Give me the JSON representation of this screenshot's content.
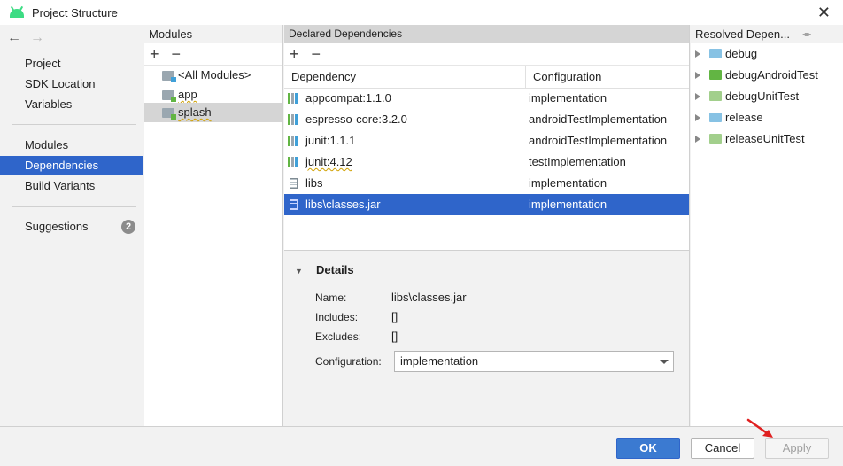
{
  "window": {
    "title": "Project Structure",
    "close_glyph": "✕"
  },
  "nav": {
    "back_glyph": "←",
    "forward_glyph": "→",
    "items": [
      {
        "label": "Project"
      },
      {
        "label": "SDK Location"
      },
      {
        "label": "Variables"
      },
      {
        "label": "Modules"
      },
      {
        "label": "Dependencies",
        "selected": true
      },
      {
        "label": "Build Variants"
      },
      {
        "label": "Suggestions",
        "badge": "2"
      }
    ]
  },
  "modules": {
    "header": "Modules",
    "minimize_glyph": "—",
    "add_glyph": "+",
    "remove_glyph": "−",
    "items": [
      {
        "label": "<All Modules>",
        "icon": "all-modules-icon"
      },
      {
        "label": "app",
        "icon": "module-icon"
      },
      {
        "label": "splash",
        "icon": "module-icon",
        "selected": true
      }
    ]
  },
  "declared": {
    "header": "Declared Dependencies",
    "add_glyph": "+",
    "remove_glyph": "−",
    "columns": [
      "Dependency",
      "Configuration"
    ],
    "rows": [
      {
        "name": "appcompat:1.1.0",
        "configuration": "implementation",
        "icon": "library-icon"
      },
      {
        "name": "espresso-core:3.2.0",
        "configuration": "androidTestImplementation",
        "icon": "library-icon"
      },
      {
        "name": "junit:1.1.1",
        "configuration": "androidTestImplementation",
        "icon": "library-icon"
      },
      {
        "name": "junit:4.12",
        "configuration": "testImplementation",
        "icon": "library-icon"
      },
      {
        "name": "libs",
        "configuration": "implementation",
        "icon": "jar-icon"
      },
      {
        "name": "libs\\classes.jar",
        "configuration": "implementation",
        "icon": "jar-icon",
        "selected": true
      }
    ]
  },
  "details": {
    "heading": "Details",
    "toggle_glyph": "▼",
    "name_label": "Name:",
    "name_value": "libs\\classes.jar",
    "includes_label": "Includes:",
    "includes_value": "[]",
    "excludes_label": "Excludes:",
    "excludes_value": "[]",
    "configuration_label": "Configuration:",
    "configuration_value": "implementation"
  },
  "resolved": {
    "header": "Resolved Depen...",
    "collapse_glyph": "⌯",
    "minimize_glyph": "—",
    "items": [
      {
        "label": "debug",
        "color": "#87c2e4"
      },
      {
        "label": "debugAndroidTest",
        "color": "#62b543"
      },
      {
        "label": "debugUnitTest",
        "color": "#a2cf8c"
      },
      {
        "label": "release",
        "color": "#87c2e4"
      },
      {
        "label": "releaseUnitTest",
        "color": "#a2cf8c"
      }
    ]
  },
  "footer": {
    "ok_label": "OK",
    "cancel_label": "Cancel",
    "apply_label": "Apply"
  },
  "colors": {
    "accent": "#2f65ca",
    "annotation_arrow": "#e02020"
  }
}
